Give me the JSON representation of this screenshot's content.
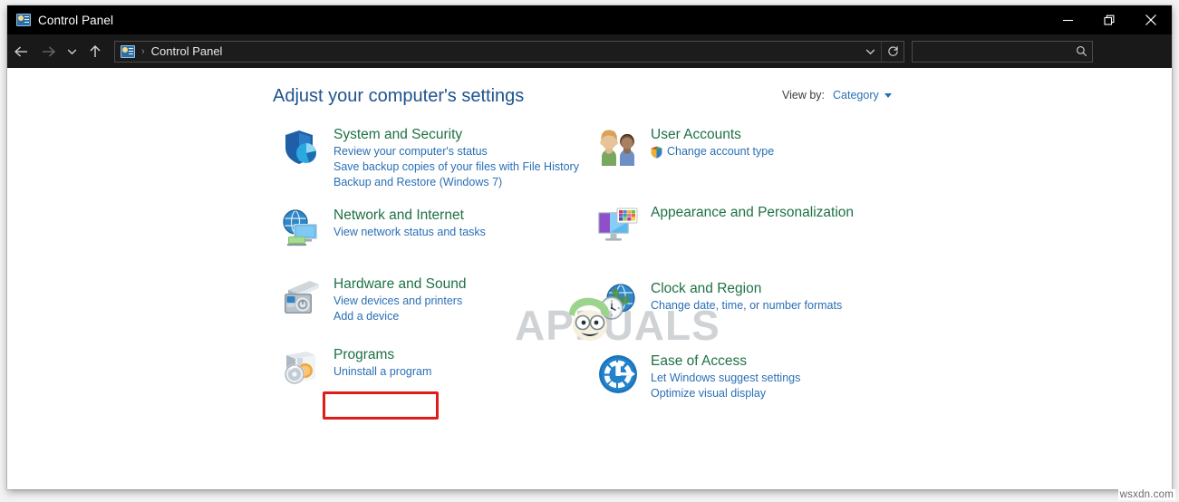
{
  "window": {
    "title": "Control Panel",
    "title_icon": "control-panel-icon",
    "controls": {
      "minimize": "minimize-icon",
      "maximize": "restore-icon",
      "close": "close-icon"
    }
  },
  "addressbar": {
    "back": "back-arrow-icon",
    "forward": "forward-arrow-icon",
    "recent": "chevron-down-icon",
    "up": "up-arrow-icon",
    "path_icon": "control-panel-icon",
    "separator": "›",
    "crumb": "Control Panel",
    "history_chevron": "chevron-down-icon",
    "refresh": "refresh-icon",
    "search": {
      "value": "",
      "placeholder": "",
      "icon": "search-icon"
    }
  },
  "main": {
    "heading": "Adjust your computer's settings",
    "view_by": {
      "label": "View by:",
      "value": "Category",
      "caret": "caret-down-icon"
    },
    "left_column": [
      {
        "id": "system-and-security",
        "title": "System and Security",
        "icon": "shield-security-icon",
        "links": [
          "Review your computer's status",
          "Save backup copies of your files with File History",
          "Backup and Restore (Windows 7)"
        ]
      },
      {
        "id": "network-and-internet",
        "title": "Network and Internet",
        "icon": "network-globe-icon",
        "links": [
          "View network status and tasks"
        ]
      },
      {
        "id": "hardware-and-sound",
        "title": "Hardware and Sound",
        "icon": "printer-icon",
        "links": [
          "View devices and printers",
          "Add a device"
        ]
      },
      {
        "id": "programs",
        "title": "Programs",
        "icon": "programs-disc-icon",
        "links": [
          "Uninstall a program"
        ]
      }
    ],
    "right_column": [
      {
        "id": "user-accounts",
        "title": "User Accounts",
        "icon": "users-icon",
        "links": [
          "Change account type"
        ],
        "link_shield": true
      },
      {
        "id": "appearance-and-personalization",
        "title": "Appearance and Personalization",
        "icon": "monitor-palette-icon",
        "links": []
      },
      {
        "id": "clock-and-region",
        "title": "Clock and Region",
        "icon": "clock-globe-icon",
        "links": [
          "Change date, time, or number formats"
        ]
      },
      {
        "id": "ease-of-access",
        "title": "Ease of Access",
        "icon": "ease-of-access-icon",
        "links": [
          "Let Windows suggest settings",
          "Optimize visual display"
        ]
      }
    ]
  },
  "annotation": {
    "highlight_target": "Uninstall a program",
    "color": "#e01b1b"
  },
  "watermarks": {
    "center": "APPUALS",
    "corner": "wsxdn.com"
  },
  "colors": {
    "titlebar_bg": "#000000",
    "addressbar_bg": "#191919",
    "heading": "#20538d",
    "category_title": "#1e7145",
    "link": "#2a6fb5",
    "annotation": "#e01b1b"
  }
}
